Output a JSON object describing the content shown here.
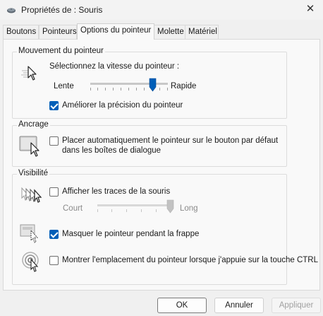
{
  "window": {
    "title": "Propriétés de : Souris",
    "close_glyph": "✕",
    "icon": "mouse-icon"
  },
  "tabs": [
    {
      "label": "Boutons"
    },
    {
      "label": "Pointeurs"
    },
    {
      "label": "Options du pointeur",
      "active": true
    },
    {
      "label": "Molette"
    },
    {
      "label": "Matériel"
    }
  ],
  "motion": {
    "title": "Mouvement du pointeur",
    "prompt": "Sélectionnez la vitesse du pointeur :",
    "slow_label": "Lente",
    "fast_label": "Rapide",
    "speed_level": 0.8,
    "precision_label": "Améliorer la précision du pointeur",
    "precision_checked": true
  },
  "snap": {
    "title": "Ancrage",
    "option_label": "Placer automatiquement le pointeur sur le bouton par défaut dans les boîtes de dialogue",
    "option_checked": false
  },
  "visibility": {
    "title": "Visibilité",
    "trails_label": "Afficher les traces de la souris",
    "trails_checked": false,
    "short_label": "Court",
    "long_label": "Long",
    "trail_level": 1.0,
    "hide_label": "Masquer le pointeur pendant la frappe",
    "hide_checked": true,
    "ctrl_label": "Montrer l'emplacement du pointeur lorsque j'appuie sur la touche CTRL",
    "ctrl_checked": false
  },
  "buttons": {
    "ok": "OK",
    "cancel": "Annuler",
    "apply": "Appliquer"
  },
  "colors": {
    "accent": "#005fb8"
  }
}
